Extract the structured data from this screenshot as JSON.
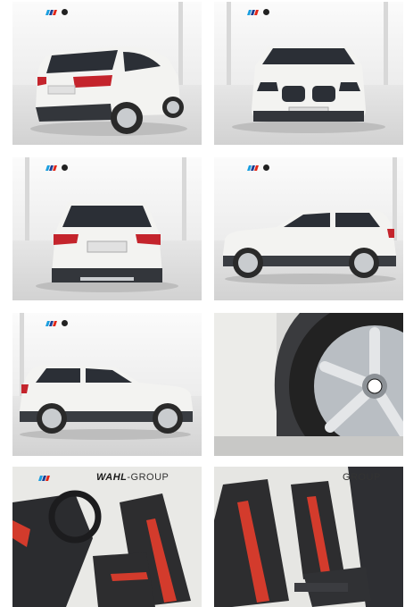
{
  "gallery": {
    "tiles": [
      {
        "view": "rear-three-quarter"
      },
      {
        "view": "front"
      },
      {
        "view": "rear"
      },
      {
        "view": "side-right"
      },
      {
        "view": "side-left"
      },
      {
        "view": "wheel-closeup"
      },
      {
        "view": "interior-driver",
        "banner": "WAHL",
        "banner_suffix": "-GROUP"
      },
      {
        "view": "interior-seats",
        "banner_suffix": "GROUP"
      }
    ]
  },
  "colors": {
    "car_body": "#f3f3f1",
    "glass": "#2b2f36",
    "taillight": "#c4242c",
    "tyre": "#2a2a2a",
    "rim": "#c9cccf",
    "seat": "#2d2d2f",
    "seat_stripe": "#d33b2c",
    "floor": "#d6d6d6"
  },
  "icons": {
    "brand_marks": [
      "m-stripes-logo",
      "bmw-roundel-icon"
    ]
  }
}
